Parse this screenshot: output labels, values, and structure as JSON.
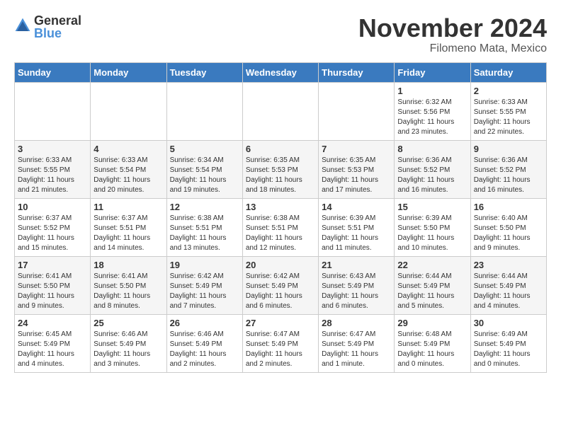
{
  "header": {
    "logo_general": "General",
    "logo_blue": "Blue",
    "month_title": "November 2024",
    "location": "Filomeno Mata, Mexico"
  },
  "calendar": {
    "days_of_week": [
      "Sunday",
      "Monday",
      "Tuesday",
      "Wednesday",
      "Thursday",
      "Friday",
      "Saturday"
    ],
    "weeks": [
      [
        {
          "day": "",
          "info": ""
        },
        {
          "day": "",
          "info": ""
        },
        {
          "day": "",
          "info": ""
        },
        {
          "day": "",
          "info": ""
        },
        {
          "day": "",
          "info": ""
        },
        {
          "day": "1",
          "info": "Sunrise: 6:32 AM\nSunset: 5:56 PM\nDaylight: 11 hours and 23 minutes."
        },
        {
          "day": "2",
          "info": "Sunrise: 6:33 AM\nSunset: 5:55 PM\nDaylight: 11 hours and 22 minutes."
        }
      ],
      [
        {
          "day": "3",
          "info": "Sunrise: 6:33 AM\nSunset: 5:55 PM\nDaylight: 11 hours and 21 minutes."
        },
        {
          "day": "4",
          "info": "Sunrise: 6:33 AM\nSunset: 5:54 PM\nDaylight: 11 hours and 20 minutes."
        },
        {
          "day": "5",
          "info": "Sunrise: 6:34 AM\nSunset: 5:54 PM\nDaylight: 11 hours and 19 minutes."
        },
        {
          "day": "6",
          "info": "Sunrise: 6:35 AM\nSunset: 5:53 PM\nDaylight: 11 hours and 18 minutes."
        },
        {
          "day": "7",
          "info": "Sunrise: 6:35 AM\nSunset: 5:53 PM\nDaylight: 11 hours and 17 minutes."
        },
        {
          "day": "8",
          "info": "Sunrise: 6:36 AM\nSunset: 5:52 PM\nDaylight: 11 hours and 16 minutes."
        },
        {
          "day": "9",
          "info": "Sunrise: 6:36 AM\nSunset: 5:52 PM\nDaylight: 11 hours and 16 minutes."
        }
      ],
      [
        {
          "day": "10",
          "info": "Sunrise: 6:37 AM\nSunset: 5:52 PM\nDaylight: 11 hours and 15 minutes."
        },
        {
          "day": "11",
          "info": "Sunrise: 6:37 AM\nSunset: 5:51 PM\nDaylight: 11 hours and 14 minutes."
        },
        {
          "day": "12",
          "info": "Sunrise: 6:38 AM\nSunset: 5:51 PM\nDaylight: 11 hours and 13 minutes."
        },
        {
          "day": "13",
          "info": "Sunrise: 6:38 AM\nSunset: 5:51 PM\nDaylight: 11 hours and 12 minutes."
        },
        {
          "day": "14",
          "info": "Sunrise: 6:39 AM\nSunset: 5:51 PM\nDaylight: 11 hours and 11 minutes."
        },
        {
          "day": "15",
          "info": "Sunrise: 6:39 AM\nSunset: 5:50 PM\nDaylight: 11 hours and 10 minutes."
        },
        {
          "day": "16",
          "info": "Sunrise: 6:40 AM\nSunset: 5:50 PM\nDaylight: 11 hours and 9 minutes."
        }
      ],
      [
        {
          "day": "17",
          "info": "Sunrise: 6:41 AM\nSunset: 5:50 PM\nDaylight: 11 hours and 9 minutes."
        },
        {
          "day": "18",
          "info": "Sunrise: 6:41 AM\nSunset: 5:50 PM\nDaylight: 11 hours and 8 minutes."
        },
        {
          "day": "19",
          "info": "Sunrise: 6:42 AM\nSunset: 5:49 PM\nDaylight: 11 hours and 7 minutes."
        },
        {
          "day": "20",
          "info": "Sunrise: 6:42 AM\nSunset: 5:49 PM\nDaylight: 11 hours and 6 minutes."
        },
        {
          "day": "21",
          "info": "Sunrise: 6:43 AM\nSunset: 5:49 PM\nDaylight: 11 hours and 6 minutes."
        },
        {
          "day": "22",
          "info": "Sunrise: 6:44 AM\nSunset: 5:49 PM\nDaylight: 11 hours and 5 minutes."
        },
        {
          "day": "23",
          "info": "Sunrise: 6:44 AM\nSunset: 5:49 PM\nDaylight: 11 hours and 4 minutes."
        }
      ],
      [
        {
          "day": "24",
          "info": "Sunrise: 6:45 AM\nSunset: 5:49 PM\nDaylight: 11 hours and 4 minutes."
        },
        {
          "day": "25",
          "info": "Sunrise: 6:46 AM\nSunset: 5:49 PM\nDaylight: 11 hours and 3 minutes."
        },
        {
          "day": "26",
          "info": "Sunrise: 6:46 AM\nSunset: 5:49 PM\nDaylight: 11 hours and 2 minutes."
        },
        {
          "day": "27",
          "info": "Sunrise: 6:47 AM\nSunset: 5:49 PM\nDaylight: 11 hours and 2 minutes."
        },
        {
          "day": "28",
          "info": "Sunrise: 6:47 AM\nSunset: 5:49 PM\nDaylight: 11 hours and 1 minute."
        },
        {
          "day": "29",
          "info": "Sunrise: 6:48 AM\nSunset: 5:49 PM\nDaylight: 11 hours and 0 minutes."
        },
        {
          "day": "30",
          "info": "Sunrise: 6:49 AM\nSunset: 5:49 PM\nDaylight: 11 hours and 0 minutes."
        }
      ]
    ]
  }
}
